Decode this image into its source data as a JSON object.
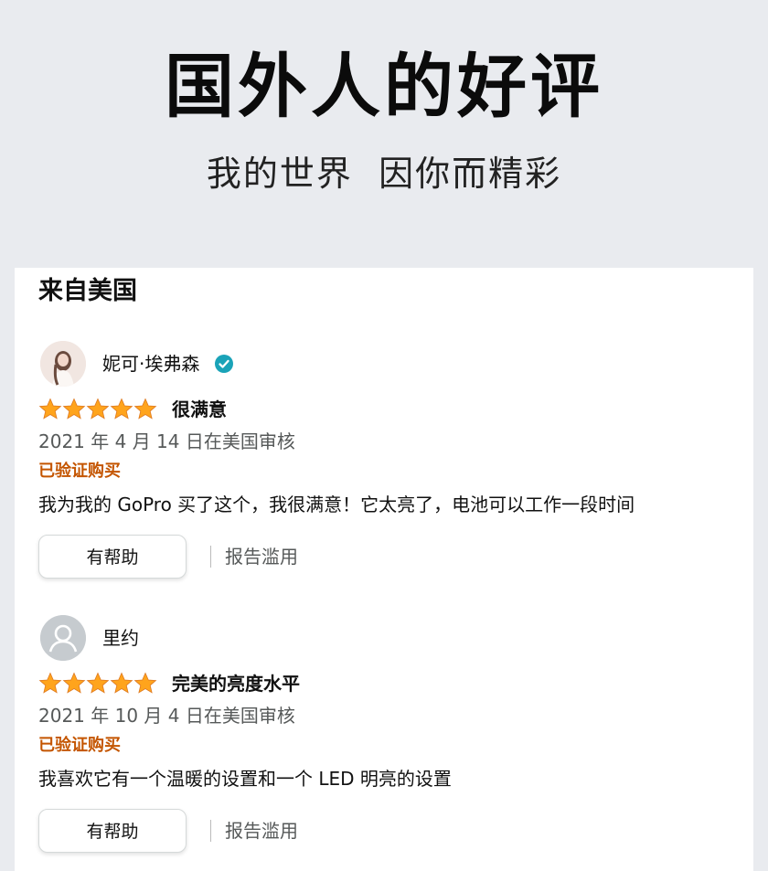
{
  "header": {
    "title": "国外人的好评",
    "subtitle": "我的世界  因你而精彩"
  },
  "section": {
    "title": "来自美国"
  },
  "reviews": [
    {
      "username": "妮可·埃弗森",
      "verified_icon": "verified-check-icon",
      "avatar": "user-photo",
      "rating": 5,
      "headline": "很满意",
      "date": "2021 年 4 月 14 日在美国审核",
      "badge": "已验证购买",
      "body": "我为我的 GoPro 买了这个，我很满意！它太亮了，电池可以工作一段时间",
      "helpful_label": "有帮助",
      "report_label": "报告滥用"
    },
    {
      "username": "里约",
      "avatar": "default-user-icon",
      "rating": 5,
      "headline": "完美的亮度水平",
      "date": "2021 年 10 月 4 日在美国审核",
      "badge": "已验证购买",
      "body": "我喜欢它有一个温暖的设置和一个 LED 明亮的设置",
      "helpful_label": "有帮助",
      "report_label": "报告滥用"
    }
  ],
  "colors": {
    "background": "#e9ebef",
    "star": "#ffa41c",
    "badge": "#c45500",
    "verified": "#1aa3b8",
    "secondary_text": "#565959"
  }
}
